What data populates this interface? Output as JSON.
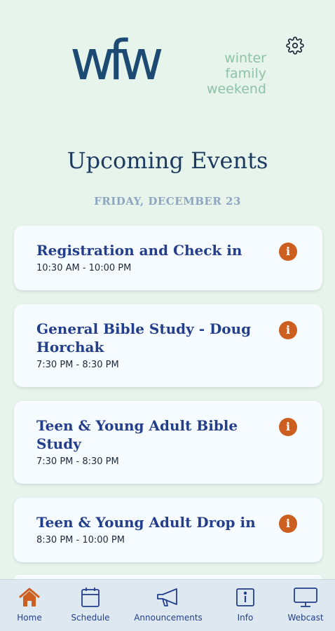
{
  "app": {
    "logo_mark": "wfw",
    "logo_words": [
      "winter",
      "family",
      "weekend"
    ]
  },
  "header": {
    "title": "Upcoming Events",
    "date": "FRIDAY, DECEMBER 23"
  },
  "events": [
    {
      "title": "Registration and Check in",
      "time": "10:30 AM - 10:00 PM"
    },
    {
      "title": "General Bible Study - Doug Horchak",
      "time": "7:30 PM - 8:30 PM"
    },
    {
      "title": "Teen & Young Adult Bible Study",
      "time": "7:30 PM - 8:30 PM"
    },
    {
      "title": "Teen & Young Adult Drop in",
      "time": "8:30 PM - 10:00 PM"
    }
  ],
  "tabs": [
    {
      "label": "Home",
      "icon": "home-icon",
      "active": true
    },
    {
      "label": "Schedule",
      "icon": "calendar-icon",
      "active": false
    },
    {
      "label": "Announcements",
      "icon": "megaphone-icon",
      "active": false
    },
    {
      "label": "Info",
      "icon": "info-icon",
      "active": false
    },
    {
      "label": "Webcast",
      "icon": "monitor-icon",
      "active": false
    }
  ],
  "colors": {
    "background": "#e6f4ec",
    "navy": "#233e8b",
    "accent": "#cc5f1f",
    "card": "#f6fbff"
  },
  "info_glyph": "i"
}
